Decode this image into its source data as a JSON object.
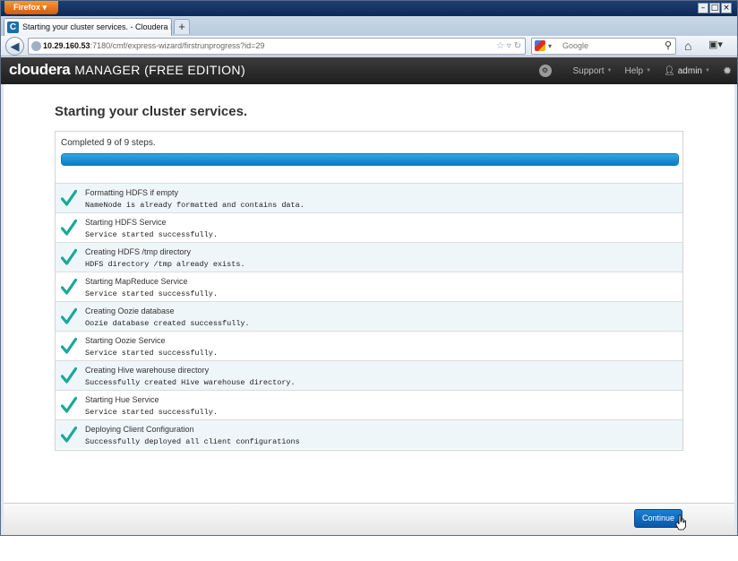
{
  "browser": {
    "app_button": "Firefox",
    "tab_title": "Starting your cluster services. - Cloudera Ma...",
    "tab_favicon": "C",
    "url_host": "10.29.160.53",
    "url_rest": ":7180/cmf/express-wizard/firstrunprogress?id=29",
    "search_placeholder": "Google",
    "icons": [
      "back-arrow-icon",
      "globe-icon",
      "star-icon",
      "reload-icon",
      "search-icon",
      "home-icon",
      "bookmarks-icon"
    ]
  },
  "header": {
    "brand": "cloudera",
    "product": "MANAGER (FREE EDITION)",
    "nav": {
      "support": "Support",
      "help": "Help",
      "user": "admin"
    }
  },
  "page": {
    "title": "Starting your cluster services.",
    "progress_label": "Completed 9 of 9 steps.",
    "progress_fraction": 1.0,
    "steps": [
      {
        "title": "Formatting HDFS if empty",
        "message": "NameNode is already formatted and contains data."
      },
      {
        "title": "Starting HDFS Service",
        "message": "Service started successfully."
      },
      {
        "title": "Creating HDFS /tmp directory",
        "message": "HDFS directory /tmp already exists."
      },
      {
        "title": "Starting MapReduce Service",
        "message": "Service started successfully."
      },
      {
        "title": "Creating Oozie database",
        "message": "Oozie database created successfully."
      },
      {
        "title": "Starting Oozie Service",
        "message": "Service started successfully."
      },
      {
        "title": "Creating Hive warehouse directory",
        "message": "Successfully created Hive warehouse directory."
      },
      {
        "title": "Starting Hue Service",
        "message": "Service started successfully."
      },
      {
        "title": "Deploying Client Configuration",
        "message": "Successfully deployed all client configurations"
      }
    ]
  },
  "footer": {
    "continue_label": "Continue"
  },
  "colors": {
    "check": "#1aa898",
    "progress": "#0a7cc0",
    "button": "#0a57a8"
  }
}
